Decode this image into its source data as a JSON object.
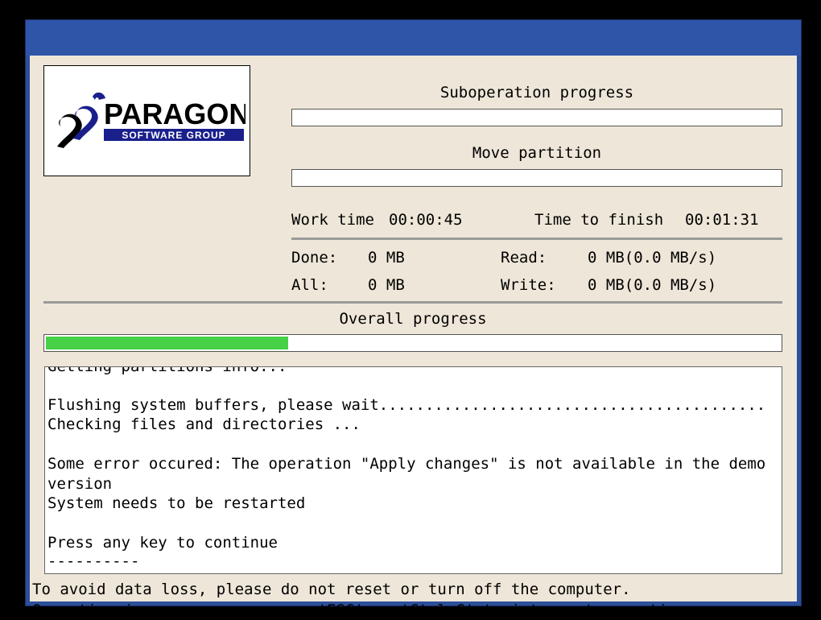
{
  "logo": {
    "brand": "PARAGON",
    "tagline": "SOFTWARE GROUP"
  },
  "suboperation": {
    "label": "Suboperation progress",
    "percent": 0
  },
  "current_task": {
    "label": "Move partition",
    "percent": 0
  },
  "times": {
    "work_label": "Work time",
    "work_value": "00:00:45",
    "finish_label": "Time to finish",
    "finish_value": "00:01:31"
  },
  "stats": {
    "done_label": "Done:",
    "done_value": "0 MB",
    "all_label": "All:",
    "all_value": "0 MB",
    "read_label": "Read:",
    "read_value": "0 MB(0.0 MB/s)",
    "write_label": "Write:",
    "write_value": "0 MB(0.0 MB/s)"
  },
  "overall": {
    "label": "Overall progress",
    "percent": 33
  },
  "log": {
    "lines": [
      "Getting partitions info...",
      "",
      "Flushing system buffers, please wait..........................................",
      "Checking files and directories ...",
      "",
      "Some error occured: The operation \"Apply changes\" is not available in the demo",
      "version",
      "System needs to be restarted",
      "",
      "Press any key to continue",
      "----------"
    ]
  },
  "footer": {
    "line1": "To avoid data loss, please do not reset or turn off the computer.",
    "line2": "Operation in progress... press 'ESC' or 'Ctrl-C' to interrupt operation"
  },
  "colors": {
    "accent": "#2f55a8",
    "progress": "#46d146",
    "panel": "#eee6d8"
  }
}
